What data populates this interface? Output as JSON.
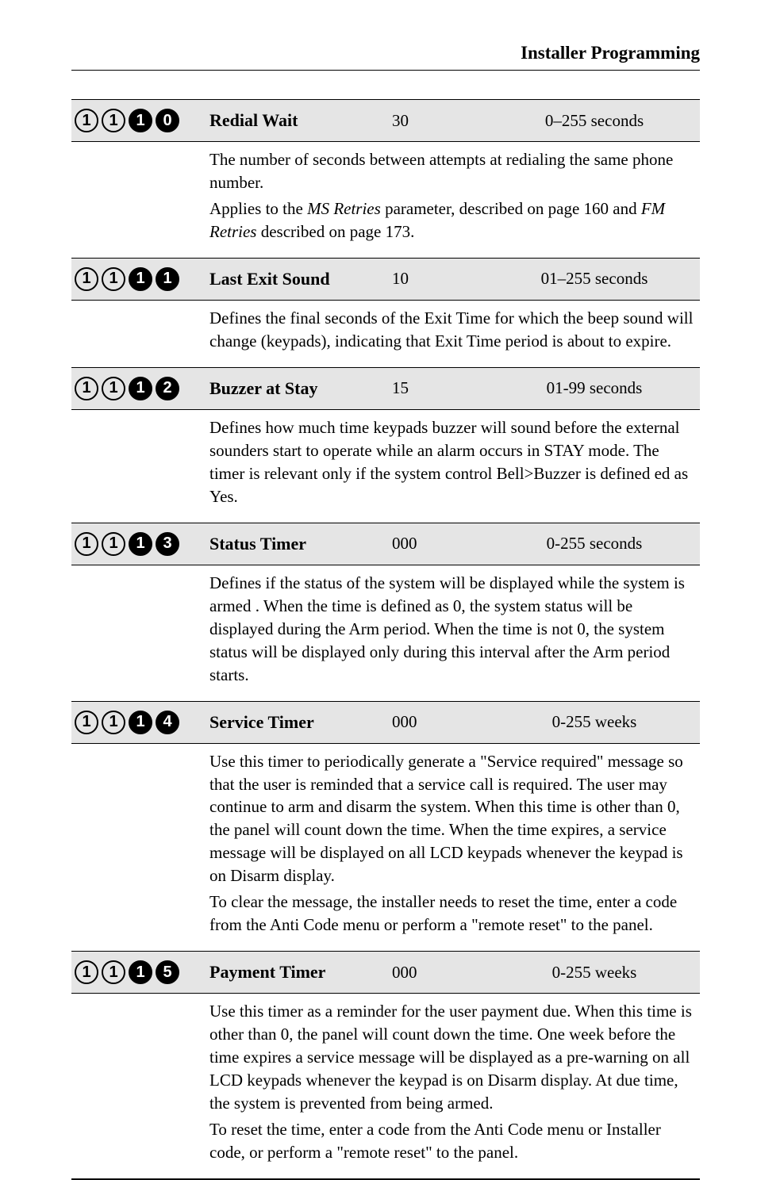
{
  "header": {
    "title": "Installer Programming"
  },
  "entries": [
    {
      "code": [
        "1",
        "1",
        "1",
        "0"
      ],
      "code_style": [
        "outline",
        "outline",
        "solid",
        "solid"
      ],
      "title": "Redial Wait",
      "default": "30",
      "range": "0–255 seconds",
      "body_parts": {
        "p1a": "The number of seconds between attempts at redialing the same phone number.",
        "p2a": "Applies to the ",
        "p2b": "MS Retries",
        "p2c": " parameter, described on page 160 and ",
        "p2d": "FM Retries",
        "p2e": " described on page 173."
      }
    },
    {
      "code": [
        "1",
        "1",
        "1",
        "1"
      ],
      "code_style": [
        "outline",
        "outline",
        "solid",
        "solid"
      ],
      "title": "Last Exit Sound",
      "default": "10",
      "range": "01–255 seconds",
      "body": "Defines the final seconds of the Exit Time for which the beep sound will change (keypads), indicating that Exit Time period is about to expire."
    },
    {
      "code": [
        "1",
        "1",
        "1",
        "2"
      ],
      "code_style": [
        "outline",
        "outline",
        "solid",
        "solid"
      ],
      "title": "Buzzer at Stay",
      "default": "15",
      "range": "01-99 seconds",
      "body": "Defines how much time keypads buzzer will sound before the external sounders start to operate while an alarm occurs in STAY mode. The timer is relevant only if the system control Bell>Buzzer is defined ed as Yes."
    },
    {
      "code": [
        "1",
        "1",
        "1",
        "3"
      ],
      "code_style": [
        "outline",
        "outline",
        "solid",
        "solid"
      ],
      "title": "Status Timer",
      "default": "000",
      "range": "0-255 seconds",
      "body": "Defines if the status of the system will be displayed while the system is armed . When the time is defined as 0, the system status will be displayed during the Arm period. When the time is not 0, the system status will be displayed only during this interval after the Arm period starts."
    },
    {
      "code": [
        "1",
        "1",
        "1",
        "4"
      ],
      "code_style": [
        "outline",
        "outline",
        "solid",
        "solid"
      ],
      "title": "Service Timer",
      "default": "000",
      "range": "0-255 weeks",
      "body_parts": {
        "p1": "Use this timer to periodically generate a \"Service required\" message so that the user is reminded that a service call is required. The user may continue to arm and disarm the system. When this time is other than 0, the panel will count down the time. When the time expires, a service message will be displayed on all LCD keypads whenever the keypad is on Disarm display.",
        "p2": "To clear the message, the installer needs to reset the time, enter a code from the Anti Code menu or perform a \"remote reset\" to the panel."
      }
    },
    {
      "code": [
        "1",
        "1",
        "1",
        "5"
      ],
      "code_style": [
        "outline",
        "outline",
        "solid",
        "solid"
      ],
      "title": "Payment Timer",
      "default": "000",
      "range": "0-255 weeks",
      "body_parts": {
        "p1": "Use this timer as a reminder for the user payment due. When this time is other than 0, the panel will count down the time. One week before the time expires a service message will be displayed as a pre-warning on all LCD keypads whenever the keypad is on Disarm display. At due time, the system is prevented from being armed.",
        "p2": "To reset the time, enter a code from the Anti Code menu or Installer code, or perform a \"remote reset\" to the panel."
      }
    }
  ]
}
